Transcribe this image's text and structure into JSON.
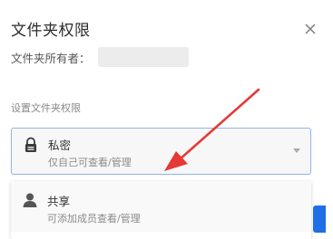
{
  "dialog": {
    "title": "文件夹权限",
    "owner_label": "文件夹所有者：",
    "section_label": "设置文件夹权限"
  },
  "selected_option": {
    "title": "私密",
    "subtitle": "仅自己可查看/管理",
    "icon": "lock-icon"
  },
  "dropdown_options": [
    {
      "title": "共享",
      "subtitle": "可添加成员查看/管理",
      "icon": "user-icon"
    }
  ],
  "colors": {
    "accent": "#1e6fe8",
    "annotation_arrow": "#e53935",
    "select_border": "#8fb3e8"
  }
}
